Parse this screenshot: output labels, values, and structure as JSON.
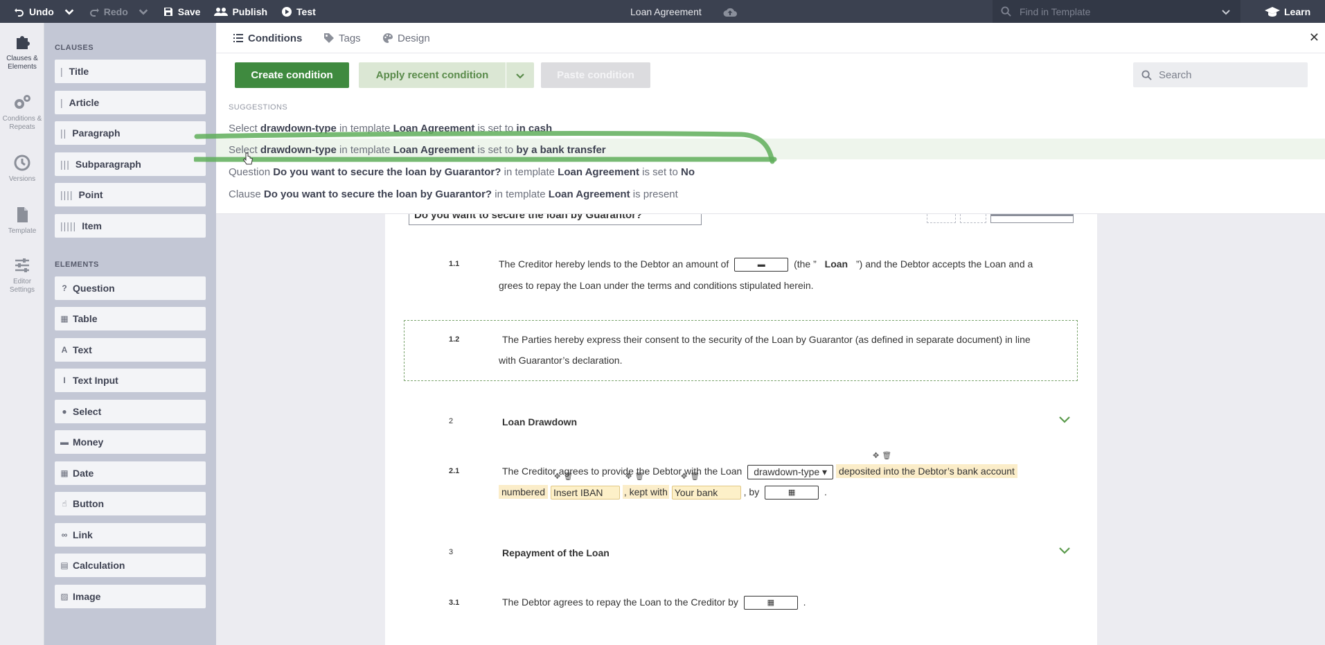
{
  "topbar": {
    "undo": "Undo",
    "redo": "Redo",
    "save": "Save",
    "publish": "Publish",
    "test": "Test",
    "doc_title": "Loan Agreement",
    "search_placeholder": "Find in Template",
    "learn": "Learn"
  },
  "rail": [
    {
      "label1": "Clauses &",
      "label2": "Elements",
      "icon": "puzzle-icon"
    },
    {
      "label1": "Conditions &",
      "label2": "Repeats",
      "icon": "gears-icon"
    },
    {
      "label1": "Versions",
      "label2": "",
      "icon": "history-icon"
    },
    {
      "label1": "Template",
      "label2": "",
      "icon": "document-icon"
    },
    {
      "label1": "Editor",
      "label2": "Settings",
      "icon": "sliders-icon"
    }
  ],
  "panel": {
    "clauses_heading": "CLAUSES",
    "clauses": [
      {
        "bars": "|",
        "label": "Title"
      },
      {
        "bars": "|",
        "label": "Article"
      },
      {
        "bars": "||",
        "label": "Paragraph"
      },
      {
        "bars": "|||",
        "label": "Subparagraph"
      },
      {
        "bars": "||||",
        "label": "Point"
      },
      {
        "bars": "|||||",
        "label": "Item"
      }
    ],
    "elements_heading": "ELEMENTS",
    "elements": [
      {
        "icon": "?",
        "label": "Question"
      },
      {
        "icon": "▦",
        "label": "Table"
      },
      {
        "icon": "A",
        "label": "Text"
      },
      {
        "icon": "I",
        "label": "Text Input"
      },
      {
        "icon": "●",
        "label": "Select"
      },
      {
        "icon": "▬",
        "label": "Money"
      },
      {
        "icon": "▦",
        "label": "Date"
      },
      {
        "icon": "☝",
        "label": "Button"
      },
      {
        "icon": "∞",
        "label": "Link"
      },
      {
        "icon": "▤",
        "label": "Calculation"
      },
      {
        "icon": "▨",
        "label": "Image"
      }
    ]
  },
  "conditions": {
    "tabs": [
      "Conditions",
      "Tags",
      "Design"
    ],
    "create_btn": "Create condition",
    "recent_btn": "Apply recent condition",
    "paste_btn": "Paste condition",
    "search_placeholder": "Search",
    "suggestions_heading": "SUGGESTIONS",
    "suggestions": [
      {
        "a": "Select ",
        "b": "drawdown-type",
        "c": " in template ",
        "d": "Loan Agreement",
        "e": " is set to ",
        "f": "in cash",
        "g": ""
      },
      {
        "a": "Select ",
        "b": "drawdown-type",
        "c": " in template ",
        "d": "Loan Agreement",
        "e": " is set to ",
        "f": "by a bank transfer",
        "g": ""
      },
      {
        "a": "Question ",
        "b": "Do you want to secure the loan by Guarantor?",
        "c": " in template ",
        "d": "Loan Agreement",
        "e": " is set to ",
        "f": "No",
        "g": ""
      },
      {
        "a": "Clause ",
        "b": "Do you want to secure the loan by Guarantor?",
        "c": " in template ",
        "d": "Loan Agreement",
        "e": " is present",
        "f": "",
        "g": ""
      }
    ]
  },
  "doc": {
    "question_title": "Do you want to secure the loan by Guarantor?",
    "p11_num": "1.1",
    "p11_a": "The Creditor hereby lends to the Debtor an amount of",
    "p11_b": "(the ”",
    "p11_loan": "Loan",
    "p11_c": "”) and the Debtor accepts the Loan and a",
    "p11_d": "grees to repay the Loan under the terms and conditions stipulated herein.",
    "p12_num": "1.2",
    "p12_a": "The Parties hereby express their consent to the security of the Loan by Guarantor (as defined in separate document) in line",
    "p12_b": "with Guarantor’s declaration.",
    "s2_num": "2",
    "s2_title": "Loan Drawdown",
    "p21_num": "2.1",
    "p21_a": "The Creditor agrees to provide the Debtor with the Loan",
    "p21_dd": "drawdown-type",
    "p21_b": "deposited into the Debtor’s bank account",
    "p21_c": "numbered",
    "p21_iban": "Insert IBAN",
    "p21_d": ", kept with",
    "p21_bank": "Your bank",
    "p21_e": ", by",
    "p21_f": ".",
    "s3_num": "3",
    "s3_title": "Repayment of the Loan",
    "p31_num": "3.1",
    "p31_a": "The Debtor agrees to repay the Loan to the Creditor by",
    "p31_b": "."
  },
  "colors": {
    "accent": "#3f8a3f",
    "topbar": "#3b4150",
    "highlight": "#fbedc9"
  }
}
